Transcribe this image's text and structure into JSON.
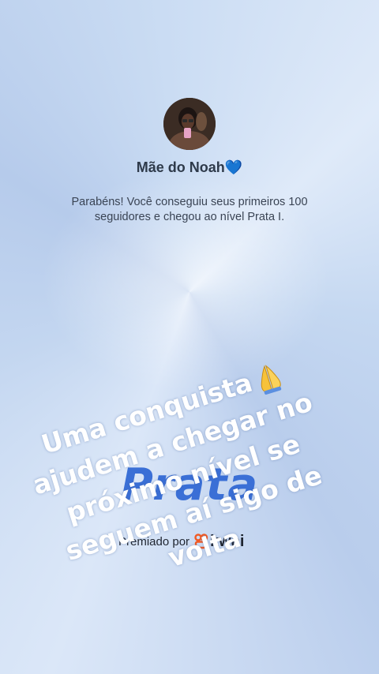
{
  "profile": {
    "username": "Mãe do Noah💙",
    "message": "Parabéns! Você conseguiu seus primeiros 100 seguidores e chegou ao nível Prata I."
  },
  "badge": {
    "level_word": "Prata",
    "awarded_by_label": "Premiado por",
    "sponsor": "kwai",
    "accent_color": "#3a6fd6"
  },
  "story_overlay": {
    "lines": [
      "Uma conquista",
      "ajudem a chegar no",
      "próximo nível se",
      "seguem aí sigo de",
      "volta"
    ],
    "emoji_icon": "praying-hands-icon",
    "color": "#ffffff"
  }
}
